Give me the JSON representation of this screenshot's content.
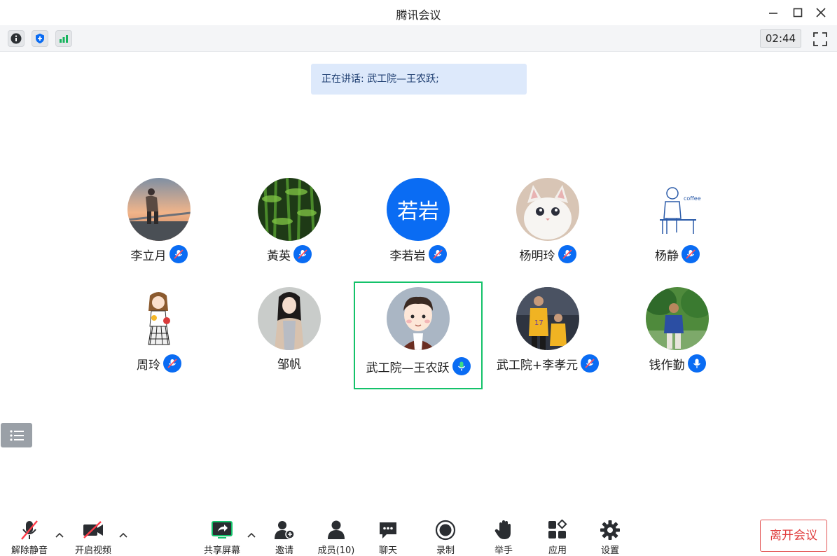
{
  "window": {
    "title": "腾讯会议"
  },
  "infobar": {
    "timer": "02:44"
  },
  "banner": {
    "text": "正在讲话: 武工院—王农跃;"
  },
  "participants": [
    {
      "name": "李立月"
    },
    {
      "name": "黃英"
    },
    {
      "name": "李若岩",
      "avatar_text": "若岩"
    },
    {
      "name": "杨明玲"
    },
    {
      "name": "杨静"
    },
    {
      "name": "周玲"
    },
    {
      "name": "邹帆"
    },
    {
      "name": "武工院—王农跃",
      "speaking": true
    },
    {
      "name": "武工院+李孝元"
    },
    {
      "name": "钱作勤"
    }
  ],
  "toolbar": {
    "unmute": "解除静音",
    "video": "开启视频",
    "share": "共享屏幕",
    "invite": "邀请",
    "members": "成员(10)",
    "chat": "聊天",
    "record": "录制",
    "raise_hand": "举手",
    "apps": "应用",
    "settings": "设置",
    "leave": "离开会议"
  },
  "colors": {
    "accent": "#0a6cf3",
    "speaking_border": "#14c26a",
    "leave": "#e03c3c",
    "banner_bg": "#dde9fb"
  },
  "icons": [
    "minimize-icon",
    "maximize-icon",
    "close-icon",
    "info-icon",
    "shield-icon",
    "signal-icon",
    "fullscreen-icon",
    "list-icon",
    "mic-muted-icon",
    "video-off-icon",
    "share-screen-icon",
    "invite-icon",
    "members-icon",
    "chat-icon",
    "record-icon",
    "hand-icon",
    "apps-icon",
    "gear-icon"
  ]
}
